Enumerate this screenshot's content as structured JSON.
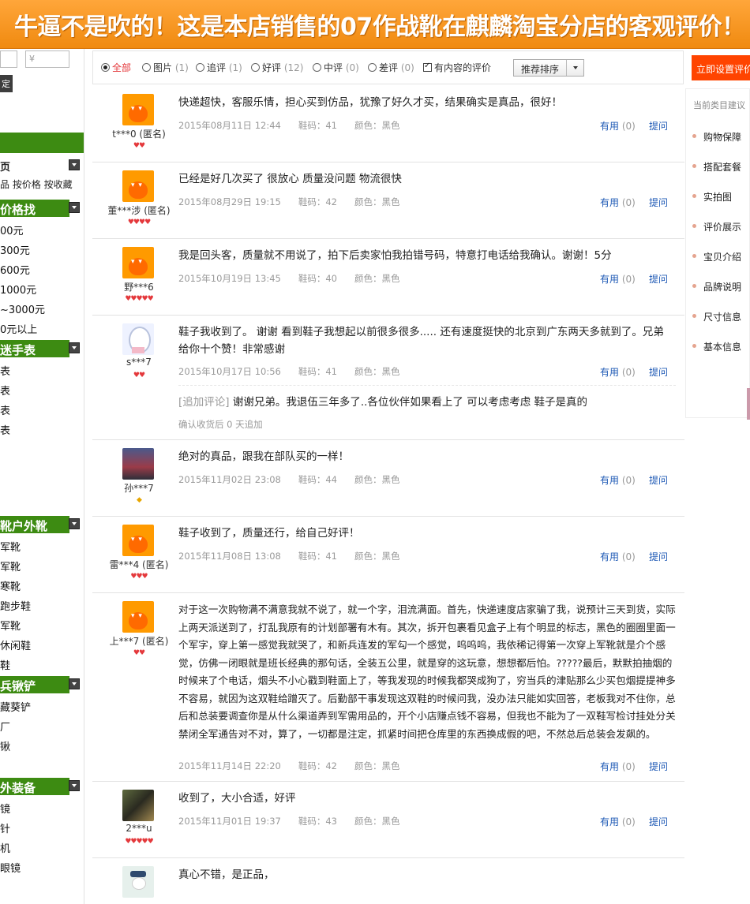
{
  "banner": {
    "title": "牛逼不是吹的！这是本店销售的07作战靴在麒麟淘宝分店的客观评价！"
  },
  "left_sidebar": {
    "price_min_placeholder": "",
    "price_max_placeholder": "¥",
    "ok_button": "定",
    "sections": [
      {
        "title": "页",
        "items": [
          "品 按价格 按收藏"
        ]
      },
      {
        "title": "价格找",
        "items": [
          "00元",
          "300元",
          "600元",
          "1000元",
          "~3000元",
          "0元以上"
        ]
      },
      {
        "title": "迷手表",
        "items": [
          "表",
          "表",
          "表",
          "表"
        ]
      },
      {
        "title": "靴户外靴",
        "items": [
          "军靴",
          "军靴",
          "寒靴",
          "跑步鞋",
          "军靴",
          "休闲鞋",
          "鞋"
        ]
      },
      {
        "title": "兵锹铲",
        "items": [
          "藏葵铲",
          "厂",
          "锹"
        ]
      },
      {
        "title": "外装备",
        "items": [
          "镜",
          "针",
          "机",
          "眼镜"
        ]
      }
    ]
  },
  "filter_bar": {
    "options": [
      {
        "label": "全部",
        "count": "",
        "selected": true
      },
      {
        "label": "图片",
        "count": "(1)"
      },
      {
        "label": "追评",
        "count": "(1)"
      },
      {
        "label": "好评",
        "count": "(12)"
      },
      {
        "label": "中评",
        "count": "(0)"
      },
      {
        "label": "差评",
        "count": "(0)"
      }
    ],
    "content_only_label": "有内容的评价",
    "sort_label": "推荐排序"
  },
  "reviews": [
    {
      "user": "t***0 (匿名)",
      "level": "♥♥",
      "avatar": "taobao",
      "content": "快递超快，客服乐情，担心买到仿品，犹豫了好久才买，结果确实是真品，很好！",
      "date": "2015年08月11日 12:44",
      "size": "鞋码：41",
      "color": "颜色：黑色",
      "useful_label": "有用",
      "useful_count": "(0)",
      "reply_label": "提问"
    },
    {
      "user": "董***涉 (匿名)",
      "level": "♥♥♥♥",
      "avatar": "taobao",
      "content": "已经是好几次买了 很放心 质量没问题 物流很快",
      "date": "2015年08月29日 19:15",
      "size": "鞋码：42",
      "color": "颜色：黑色",
      "useful_label": "有用",
      "useful_count": "(0)",
      "reply_label": "提问"
    },
    {
      "user": "野***6",
      "level": "♥♥♥♥♥",
      "avatar": "taobao",
      "content": "我是回头客，质量就不用说了，拍下后卖家怕我拍错号码，特意打电话给我确认。谢谢！5分",
      "date": "2015年10月19日 13:45",
      "size": "鞋码：40",
      "color": "颜色：黑色",
      "useful_label": "有用",
      "useful_count": "(0)",
      "reply_label": "提问"
    },
    {
      "user": "s***7",
      "level": "♥♥",
      "avatar": "cartoon",
      "content": "鞋子我收到了。 谢谢 看到鞋子我想起以前很多很多..... 还有速度挺快的北京到广东两天多就到了。兄弟 给你十个赞！非常感谢",
      "date": "2015年10月17日 10:56",
      "size": "鞋码：41",
      "color": "颜色：黑色",
      "useful_label": "有用",
      "useful_count": "(0)",
      "reply_label": "提问",
      "append_tag": "[追加评论]",
      "append_text": "谢谢兄弟。我退伍三年多了..各位伙伴如果看上了 可以考虑考虑 鞋子是真的",
      "append_note": "确认收货后 0 天追加"
    },
    {
      "user": "孙***7",
      "level": "◆",
      "avatar": "photo1",
      "content": "绝对的真品，跟我在部队买的一样！",
      "date": "2015年11月02日 23:08",
      "size": "鞋码：44",
      "color": "颜色：黑色",
      "useful_label": "有用",
      "useful_count": "(0)",
      "reply_label": "提问"
    },
    {
      "user": "雷***4 (匿名)",
      "level": "♥♥♥",
      "avatar": "taobao",
      "content": "鞋子收到了，质量还行，给自己好评！",
      "date": "2015年11月08日 13:08",
      "size": "鞋码：41",
      "color": "颜色：黑色",
      "useful_label": "有用",
      "useful_count": "(0)",
      "reply_label": "提问"
    },
    {
      "user": "上***7 (匿名)",
      "level": "♥♥",
      "avatar": "taobao",
      "content": "对于这一次购物满不满意我就不说了，就一个字，泪流满面。首先，快递速度店家骗了我，说预计三天到货，实际上两天派送到了，打乱我原有的计划部署有木有。其次，拆开包裹看见盒子上有个明显的标志，黑色的圈圈里面一个军字，穿上第一感觉我就哭了，和新兵连发的军勾一个感觉，呜呜呜，我依稀记得第一次穿上军靴就是介个感觉，仿佛一闭眼就是班长经典的那句话，全装五公里，就是穿的这玩意，想想都后怕。?????最后，默默拍抽烟的时候来了个电话，烟头不小心戳到鞋面上了，等我发现的时候我都哭成狗了，穷当兵的津贴那么少买包烟提提神多不容易，就因为这双鞋给蹭灭了。后勤部干事发现这双鞋的时候问我，没办法只能如实回答，老板我对不住你，总后和总装要调查你是从什么渠道弄到军需用品的，开个小店赚点钱不容易，但我也不能为了一双鞋写检讨挂处分关禁闭全军通告对不对，算了，一切都是注定，抓紧时间把仓库里的东西换成假的吧，不然总后总装会发飙的。",
      "date": "2015年11月14日 22:20",
      "size": "鞋码：42",
      "color": "颜色：黑色",
      "useful_label": "有用",
      "useful_count": "(0)",
      "reply_label": "提问"
    },
    {
      "user": "2***u",
      "level": "♥♥♥♥♥",
      "avatar": "photo2",
      "content": "收到了，大小合适，好评",
      "date": "2015年11月01日 19:37",
      "size": "鞋码：43",
      "color": "颜色：黑色",
      "useful_label": "有用",
      "useful_count": "(0)",
      "reply_label": "提问"
    },
    {
      "user": "",
      "level": "",
      "avatar": "photo3",
      "content": "真心不错，是正品，",
      "date": "",
      "size": "",
      "color": "",
      "useful_label": "",
      "useful_count": "",
      "reply_label": ""
    }
  ],
  "right_sidebar": {
    "button": "立即设置评价",
    "title": "当前类目建议",
    "items": [
      "购物保障",
      "搭配套餐",
      "实拍图",
      "评价展示",
      "宝贝介绍",
      "品牌说明",
      "尺寸信息",
      "基本信息"
    ]
  }
}
